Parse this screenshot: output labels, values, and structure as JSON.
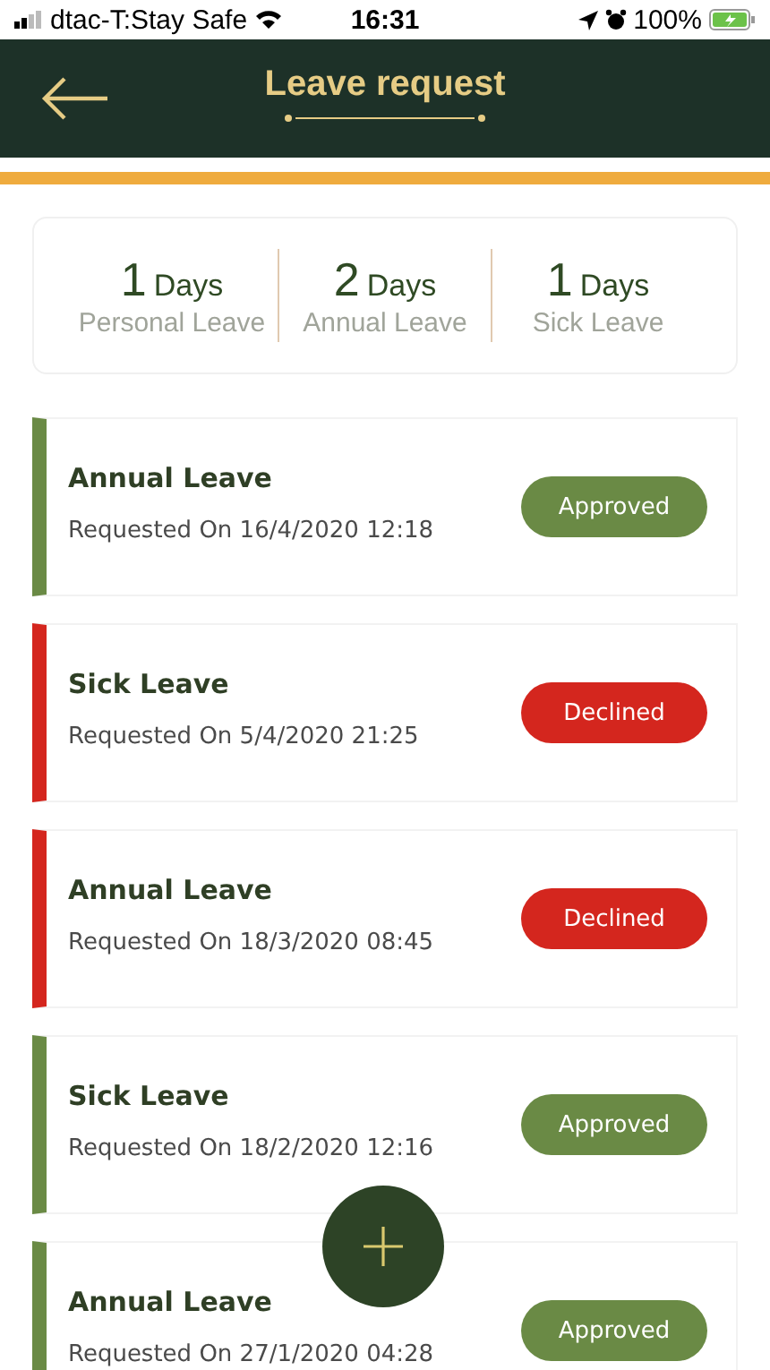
{
  "status_bar": {
    "carrier": "dtac-T:Stay Safe",
    "time": "16:31",
    "battery": "100%"
  },
  "header": {
    "title": "Leave request"
  },
  "summary": [
    {
      "count": "1",
      "unit": "Days",
      "label": "Personal Leave"
    },
    {
      "count": "2",
      "unit": "Days",
      "label": "Annual Leave"
    },
    {
      "count": "1",
      "unit": "Days",
      "label": "Sick Leave"
    }
  ],
  "requests": [
    {
      "type": "Annual Leave",
      "requested": "Requested On 16/4/2020 12:18",
      "status": "Approved",
      "kind": "approved"
    },
    {
      "type": "Sick Leave",
      "requested": "Requested On 5/4/2020 21:25",
      "status": "Declined",
      "kind": "declined"
    },
    {
      "type": "Annual Leave",
      "requested": "Requested On 18/3/2020 08:45",
      "status": "Declined",
      "kind": "declined"
    },
    {
      "type": "Sick Leave",
      "requested": "Requested On 18/2/2020 12:16",
      "status": "Approved",
      "kind": "approved"
    },
    {
      "type": "Annual Leave",
      "requested": "Requested On 27/1/2020 04:28",
      "status": "Approved",
      "kind": "approved"
    }
  ]
}
